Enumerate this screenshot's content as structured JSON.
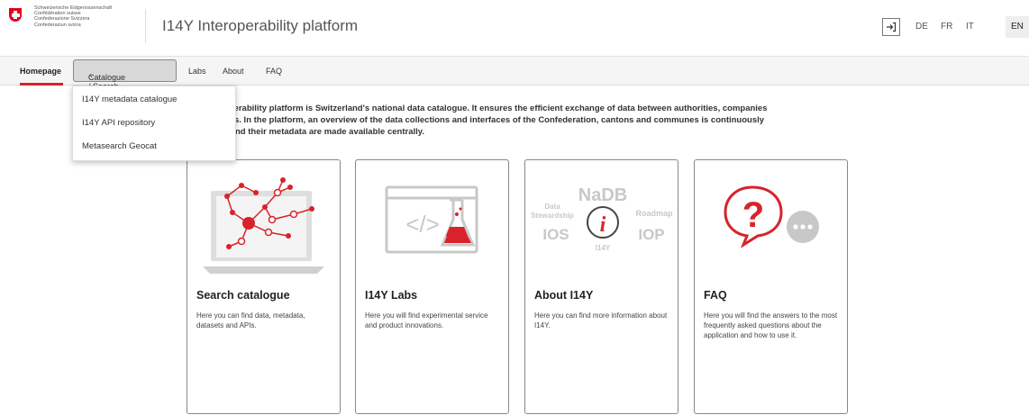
{
  "header": {
    "confederation_lines": [
      "Schweizerische Eidgenossenschaft",
      "Confédération suisse",
      "Confederazione Svizzera",
      "Confederaziun svizra"
    ],
    "app_title": "I14Y Interoperability platform",
    "languages": [
      "DE",
      "FR",
      "IT",
      "EN"
    ],
    "active_language": "EN",
    "login_icon": "login-icon"
  },
  "nav": {
    "items": [
      {
        "label": "Homepage"
      },
      {
        "label": "Catalogue / Search"
      },
      {
        "label": "Labs"
      },
      {
        "label": "About"
      },
      {
        "label": "FAQ"
      }
    ],
    "catalogue_chevron": "^"
  },
  "dropdown": {
    "items": [
      {
        "label": "I14Y metadata catalogue"
      },
      {
        "label": "I14Y API repository"
      },
      {
        "label": "Metasearch Geocat"
      }
    ]
  },
  "intro": {
    "lines": [
      "nteroperability platform is Switzerland's national data catalogue. It ensures the efficient exchange of data between authorities, companies",
      "s. In the platform, an overview of the data collections and interfaces of the Confederation, cantons and communes is continuously",
      "nd their metadata are made available centrally."
    ]
  },
  "cards": [
    {
      "title": "Search catalogue",
      "desc": "Here you can find data, metadata, datasets and APIs."
    },
    {
      "title": "I14Y Labs",
      "desc": "Here you will find experimental service and product innovations."
    },
    {
      "title": "About I14Y",
      "desc": "Here you can find more information about I14Y."
    },
    {
      "title": "FAQ",
      "desc": "Here you will find the answers to the most frequently asked questions about the application and how to use it."
    }
  ],
  "about_illustration": {
    "words": [
      "NaDB",
      "Data",
      "Stewardship",
      "Roadmap",
      "IOS",
      "IOP",
      "I14Y"
    ]
  },
  "labs_illustration": {
    "code_symbol": "</>"
  },
  "faq_illustration": {
    "question_mark": "?",
    "dots": "ooo"
  },
  "colors": {
    "accent_red": "#d8232a",
    "swiss_red": "#e2001a",
    "illustration_gray": "#c8c8c8"
  }
}
